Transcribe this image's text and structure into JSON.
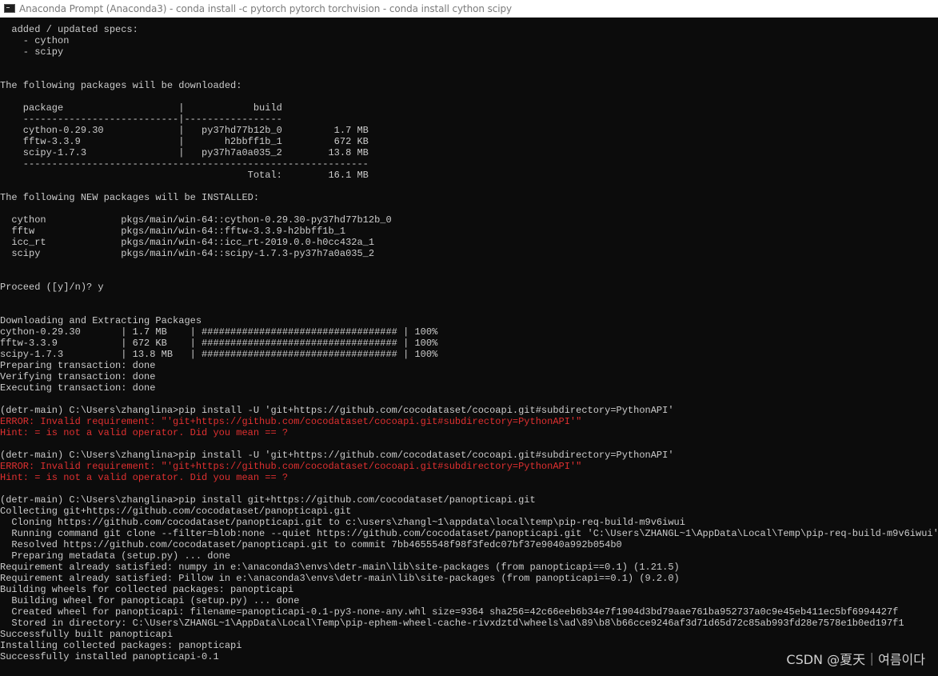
{
  "window": {
    "title": "Anaconda Prompt (Anaconda3) - conda  install -c pytorch pytorch torchvision - conda  install cython scipy"
  },
  "console": {
    "lines": [
      {
        "text": "  added / updated specs:",
        "error": false
      },
      {
        "text": "    - cython",
        "error": false
      },
      {
        "text": "    - scipy",
        "error": false
      },
      {
        "text": "",
        "error": false
      },
      {
        "text": "",
        "error": false
      },
      {
        "text": "The following packages will be downloaded:",
        "error": false
      },
      {
        "text": "",
        "error": false
      },
      {
        "text": "    package                    |            build",
        "error": false
      },
      {
        "text": "    ---------------------------|-----------------",
        "error": false
      },
      {
        "text": "    cython-0.29.30             |   py37hd77b12b_0         1.7 MB",
        "error": false
      },
      {
        "text": "    fftw-3.3.9                 |       h2bbff1b_1         672 KB",
        "error": false
      },
      {
        "text": "    scipy-1.7.3                |   py37h7a0a035_2        13.8 MB",
        "error": false
      },
      {
        "text": "    ------------------------------------------------------------",
        "error": false
      },
      {
        "text": "                                           Total:        16.1 MB",
        "error": false
      },
      {
        "text": "",
        "error": false
      },
      {
        "text": "The following NEW packages will be INSTALLED:",
        "error": false
      },
      {
        "text": "",
        "error": false
      },
      {
        "text": "  cython             pkgs/main/win-64::cython-0.29.30-py37hd77b12b_0",
        "error": false
      },
      {
        "text": "  fftw               pkgs/main/win-64::fftw-3.3.9-h2bbff1b_1",
        "error": false
      },
      {
        "text": "  icc_rt             pkgs/main/win-64::icc_rt-2019.0.0-h0cc432a_1",
        "error": false
      },
      {
        "text": "  scipy              pkgs/main/win-64::scipy-1.7.3-py37h7a0a035_2",
        "error": false
      },
      {
        "text": "",
        "error": false
      },
      {
        "text": "",
        "error": false
      },
      {
        "text": "Proceed ([y]/n)? y",
        "error": false
      },
      {
        "text": "",
        "error": false
      },
      {
        "text": "",
        "error": false
      },
      {
        "text": "Downloading and Extracting Packages",
        "error": false
      },
      {
        "text": "cython-0.29.30       | 1.7 MB    | ################################## | 100%",
        "error": false
      },
      {
        "text": "fftw-3.3.9           | 672 KB    | ################################## | 100%",
        "error": false
      },
      {
        "text": "scipy-1.7.3          | 13.8 MB   | ################################## | 100%",
        "error": false
      },
      {
        "text": "Preparing transaction: done",
        "error": false
      },
      {
        "text": "Verifying transaction: done",
        "error": false
      },
      {
        "text": "Executing transaction: done",
        "error": false
      },
      {
        "text": "",
        "error": false
      },
      {
        "text": "(detr-main) C:\\Users\\zhanglina>pip install -U 'git+https://github.com/cocodataset/cocoapi.git#subdirectory=PythonAPI'",
        "error": false
      },
      {
        "text": "ERROR: Invalid requirement: \"'git+https://github.com/cocodataset/cocoapi.git#subdirectory=PythonAPI'\"",
        "error": true
      },
      {
        "text": "Hint: = is not a valid operator. Did you mean == ?",
        "error": true
      },
      {
        "text": "",
        "error": false
      },
      {
        "text": "(detr-main) C:\\Users\\zhanglina>pip install -U 'git+https://github.com/cocodataset/cocoapi.git#subdirectory=PythonAPI'",
        "error": false
      },
      {
        "text": "ERROR: Invalid requirement: \"'git+https://github.com/cocodataset/cocoapi.git#subdirectory=PythonAPI'\"",
        "error": true
      },
      {
        "text": "Hint: = is not a valid operator. Did you mean == ?",
        "error": true
      },
      {
        "text": "",
        "error": false
      },
      {
        "text": "(detr-main) C:\\Users\\zhanglina>pip install git+https://github.com/cocodataset/panopticapi.git",
        "error": false
      },
      {
        "text": "Collecting git+https://github.com/cocodataset/panopticapi.git",
        "error": false
      },
      {
        "text": "  Cloning https://github.com/cocodataset/panopticapi.git to c:\\users\\zhangl~1\\appdata\\local\\temp\\pip-req-build-m9v6iwui",
        "error": false
      },
      {
        "text": "  Running command git clone --filter=blob:none --quiet https://github.com/cocodataset/panopticapi.git 'C:\\Users\\ZHANGL~1\\AppData\\Local\\Temp\\pip-req-build-m9v6iwui'",
        "error": false
      },
      {
        "text": "  Resolved https://github.com/cocodataset/panopticapi.git to commit 7bb4655548f98f3fedc07bf37e9040a992b054b0",
        "error": false
      },
      {
        "text": "  Preparing metadata (setup.py) ... done",
        "error": false
      },
      {
        "text": "Requirement already satisfied: numpy in e:\\anaconda3\\envs\\detr-main\\lib\\site-packages (from panopticapi==0.1) (1.21.5)",
        "error": false
      },
      {
        "text": "Requirement already satisfied: Pillow in e:\\anaconda3\\envs\\detr-main\\lib\\site-packages (from panopticapi==0.1) (9.2.0)",
        "error": false
      },
      {
        "text": "Building wheels for collected packages: panopticapi",
        "error": false
      },
      {
        "text": "  Building wheel for panopticapi (setup.py) ... done",
        "error": false
      },
      {
        "text": "  Created wheel for panopticapi: filename=panopticapi-0.1-py3-none-any.whl size=9364 sha256=42c66eeb6b34e7f1904d3bd79aae761ba952737a0c9e45eb411ec5bf6994427f",
        "error": false
      },
      {
        "text": "  Stored in directory: C:\\Users\\ZHANGL~1\\AppData\\Local\\Temp\\pip-ephem-wheel-cache-rivxdztd\\wheels\\ad\\89\\b8\\b66cce9246af3d71d65d72c85ab993fd28e7578e1b0ed197f1",
        "error": false
      },
      {
        "text": "Successfully built panopticapi",
        "error": false
      },
      {
        "text": "Installing collected packages: panopticapi",
        "error": false
      },
      {
        "text": "Successfully installed panopticapi-0.1",
        "error": false
      }
    ]
  },
  "watermark": {
    "text": "CSDN @夏天｜여름이다"
  }
}
